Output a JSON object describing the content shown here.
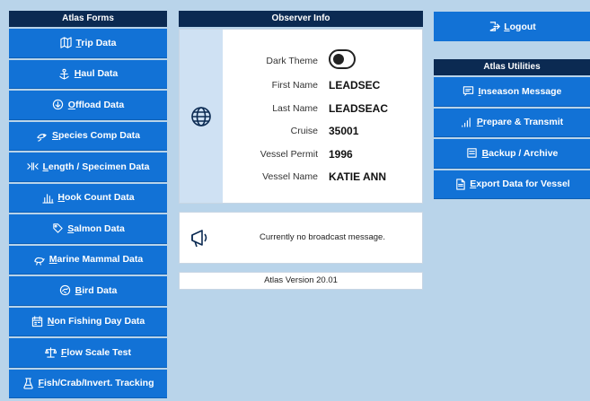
{
  "forms": {
    "title": "Atlas Forms",
    "items": [
      {
        "label": "Trip Data",
        "u": "T",
        "rest": "rip Data",
        "icon": "map-icon"
      },
      {
        "label": "Haul Data",
        "u": "H",
        "rest": "aul Data",
        "icon": "anchor-icon"
      },
      {
        "label": "Offload Data",
        "u": "O",
        "rest": "ffload Data",
        "icon": "offload-icon"
      },
      {
        "label": "Species Comp Data",
        "u": "S",
        "rest": "pecies Comp Data",
        "icon": "species-icon"
      },
      {
        "label": "Length / Specimen Data",
        "u": "L",
        "rest": "ength / Specimen Data",
        "icon": "ruler-icon"
      },
      {
        "label": "Hook Count Data",
        "u": "H",
        "rest": "ook Count Data",
        "icon": "bar-chart-icon"
      },
      {
        "label": "Salmon Data",
        "u": "S",
        "rest": "almon Data",
        "icon": "tag-icon"
      },
      {
        "label": "Marine Mammal Data",
        "u": "M",
        "rest": "arine Mammal Data",
        "icon": "mammal-icon"
      },
      {
        "label": "Bird Data",
        "u": "B",
        "rest": "ird Data",
        "icon": "bird-icon"
      },
      {
        "label": "Non Fishing Day Data",
        "u": "N",
        "rest": "on Fishing Day Data",
        "icon": "calendar-icon"
      },
      {
        "label": "Flow Scale Test",
        "u": "F",
        "rest": "low Scale Test",
        "icon": "scale-icon"
      },
      {
        "label": "Fish/Crab/Invert. Tracking",
        "u": "F",
        "rest": "ish/Crab/Invert. Tracking",
        "icon": "flask-icon"
      }
    ]
  },
  "observer": {
    "title": "Observer Info",
    "dark_theme_label": "Dark Theme",
    "dark_theme_on": false,
    "fields": [
      {
        "label": "First Name",
        "value": "LEADSEC"
      },
      {
        "label": "Last Name",
        "value": "LEADSEAC"
      },
      {
        "label": "Cruise",
        "value": "35001"
      },
      {
        "label": "Vessel Permit",
        "value": "1996"
      },
      {
        "label": "Vessel Name",
        "value": "KATIE ANN"
      }
    ]
  },
  "broadcast": {
    "message": "Currently no broadcast message."
  },
  "version": "Atlas Version 20.01",
  "logout": {
    "label": "Logout",
    "u": "L",
    "rest": "ogout"
  },
  "utilities": {
    "title": "Atlas Utilities",
    "items": [
      {
        "label": "Inseason Message",
        "u": "I",
        "rest": "nseason Message",
        "icon": "message-icon"
      },
      {
        "label": "Prepare & Transmit",
        "u": "P",
        "rest": "repare & Transmit",
        "icon": "signal-icon"
      },
      {
        "label": "Backup / Archive",
        "u": "B",
        "rest": "ackup / Archive",
        "icon": "backup-icon"
      },
      {
        "label": "Export Data for Vessel",
        "u": "E",
        "rest": "xport Data for Vessel",
        "icon": "export-icon"
      }
    ]
  },
  "colors": {
    "background": "#b9d4ea",
    "button": "#1272d6",
    "header": "#0b2a52",
    "card": "#ffffff",
    "icon_strip": "#cfe1f3"
  }
}
